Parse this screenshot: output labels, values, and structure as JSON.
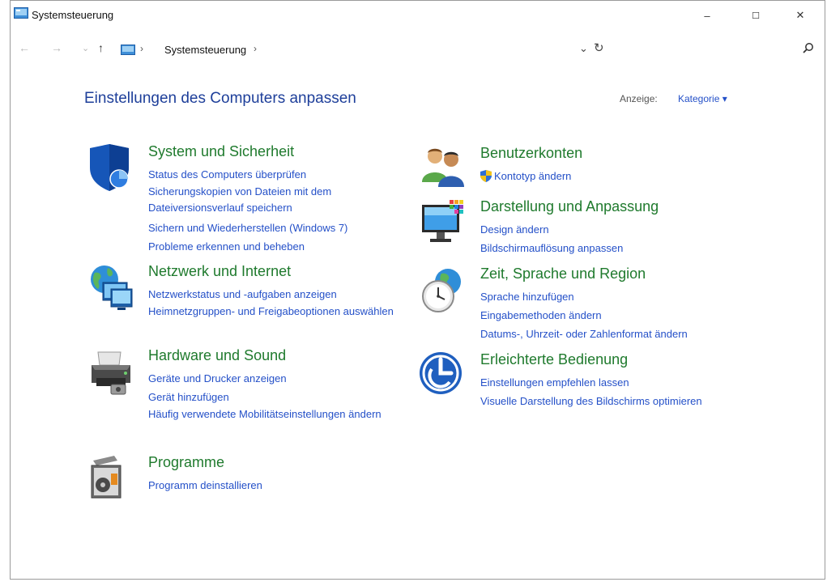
{
  "window": {
    "title": "Systemsteuerung"
  },
  "titlebar": {
    "minimize": "–",
    "maximize": "☐",
    "close": "✕"
  },
  "addressbar": {
    "back": "←",
    "forward": "→",
    "recent": "⌄",
    "up": "↑",
    "crumb_sep": "›",
    "breadcrumb": "Systemsteuerung",
    "dropdown": "⌄",
    "refresh": "↻",
    "search_placeholder": ""
  },
  "main": {
    "title": "Einstellungen des Computers anpassen",
    "view_label": "Anzeige:",
    "view_value": "Kategorie ▾"
  },
  "categories": {
    "system": {
      "heading": "System und Sicherheit",
      "links": [
        "Status des Computers überprüfen",
        "Sicherungskopien von Dateien mit dem Dateiversionsverlauf speichern",
        "Sichern und Wiederherstellen (Windows 7)",
        "Probleme erkennen und beheben"
      ]
    },
    "network": {
      "heading": "Netzwerk und Internet",
      "links": [
        "Netzwerkstatus und -aufgaben anzeigen",
        "Heimnetzgruppen- und Freigabeoptionen auswählen"
      ]
    },
    "hardware": {
      "heading": "Hardware und Sound",
      "links": [
        "Geräte und Drucker anzeigen",
        "Gerät hinzufügen",
        "Häufig verwendete Mobilitätseinstellungen ändern"
      ]
    },
    "programs": {
      "heading": "Programme",
      "links": [
        "Programm deinstallieren"
      ]
    },
    "accounts": {
      "heading": "Benutzerkonten",
      "links": [
        "Kontotyp ändern"
      ]
    },
    "appearance": {
      "heading": "Darstellung und Anpassung",
      "links": [
        "Design ändern",
        "Bildschirmauflösung anpassen"
      ]
    },
    "region": {
      "heading": "Zeit, Sprache und Region",
      "links": [
        "Sprache hinzufügen",
        "Eingabemethoden ändern",
        "Datums-, Uhrzeit- oder Zahlenformat ändern"
      ]
    },
    "ease": {
      "heading": "Erleichterte Bedienung",
      "links": [
        "Einstellungen empfehlen lassen",
        "Visuelle Darstellung des Bildschirms optimieren"
      ]
    }
  }
}
